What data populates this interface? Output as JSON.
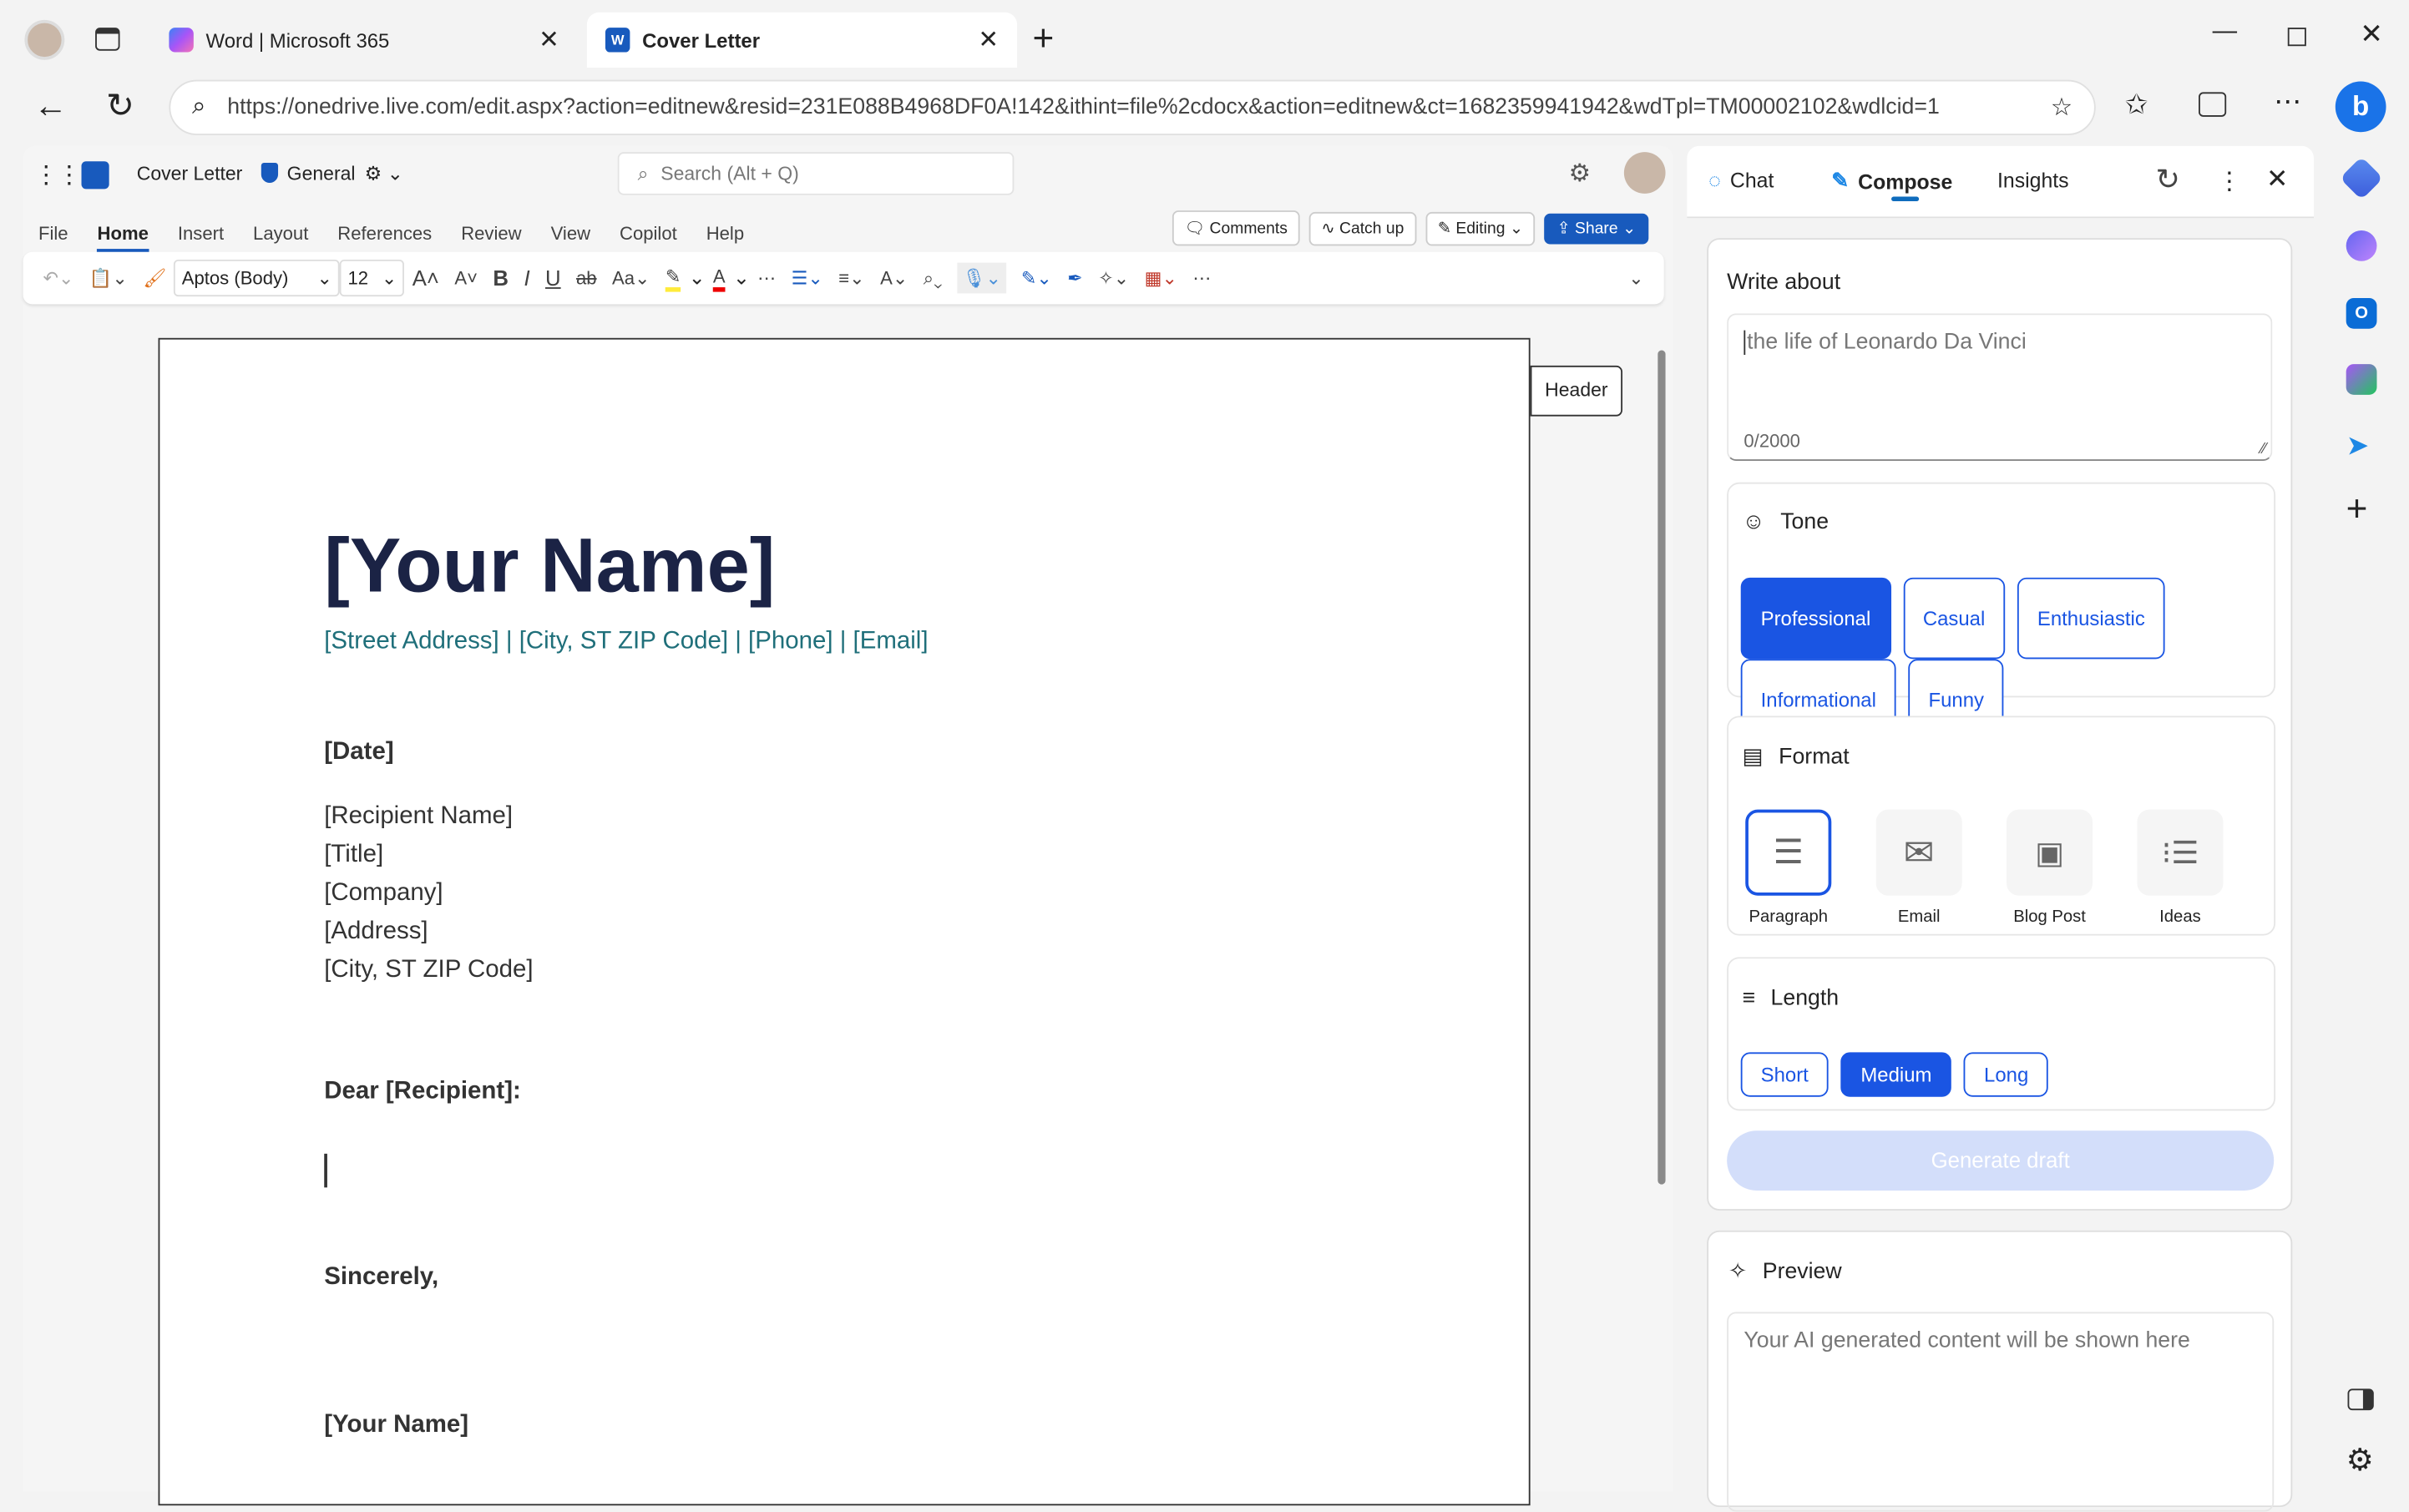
{
  "browser": {
    "tabs": [
      {
        "label": "Word | Microsoft 365",
        "active": false
      },
      {
        "label": "Cover Letter",
        "active": true
      }
    ],
    "url": "https://onedrive.live.com/edit.aspx?action=editnew&resid=231E088B4968DF0A!142&ithint=file%2cdocx&action=editnew&ct=1682359941942&wdTpl=TM00002102&wdlcid=1"
  },
  "word": {
    "doc_title": "Cover Letter",
    "sensitivity": "General",
    "search_placeholder": "Search (Alt + Q)",
    "menu": [
      "File",
      "Home",
      "Insert",
      "Layout",
      "References",
      "Review",
      "View",
      "Copilot",
      "Help"
    ],
    "active_menu": "Home",
    "actions": {
      "comments": "Comments",
      "catchup": "Catch up",
      "editing": "Editing",
      "share": "Share"
    },
    "font": "Aptos (Body)",
    "font_size": "12",
    "header_tag": "Header"
  },
  "document": {
    "name": "[Your Name]",
    "contact": "[Street Address] | [City, ST ZIP Code] | [Phone] | [Email]",
    "date": "[Date]",
    "recipient": [
      "[Recipient Name]",
      "[Title]",
      "[Company]",
      "[Address]",
      "[City, ST ZIP Code]"
    ],
    "salutation": "Dear [Recipient]:",
    "closing": "Sincerely,",
    "signature": "[Your Name]"
  },
  "copilot": {
    "tabs": [
      "Chat",
      "Compose",
      "Insights"
    ],
    "active_tab": "Compose",
    "write_about": "Write about",
    "placeholder": "the life of Leonardo Da Vinci",
    "counter": "0/2000",
    "tone_label": "Tone",
    "tones": [
      "Professional",
      "Casual",
      "Enthusiastic",
      "Informational",
      "Funny"
    ],
    "selected_tone": "Professional",
    "format_label": "Format",
    "formats": [
      "Paragraph",
      "Email",
      "Blog Post",
      "Ideas"
    ],
    "selected_format": "Paragraph",
    "length_label": "Length",
    "lengths": [
      "Short",
      "Medium",
      "Long"
    ],
    "selected_length": "Medium",
    "generate": "Generate draft",
    "preview_label": "Preview",
    "preview_placeholder": "Your AI generated content will be shown here"
  },
  "colors": {
    "accent": "#1a55e3",
    "word_blue": "#185abd",
    "name_color": "#1b2345",
    "contact_color": "#1f6f7a"
  }
}
